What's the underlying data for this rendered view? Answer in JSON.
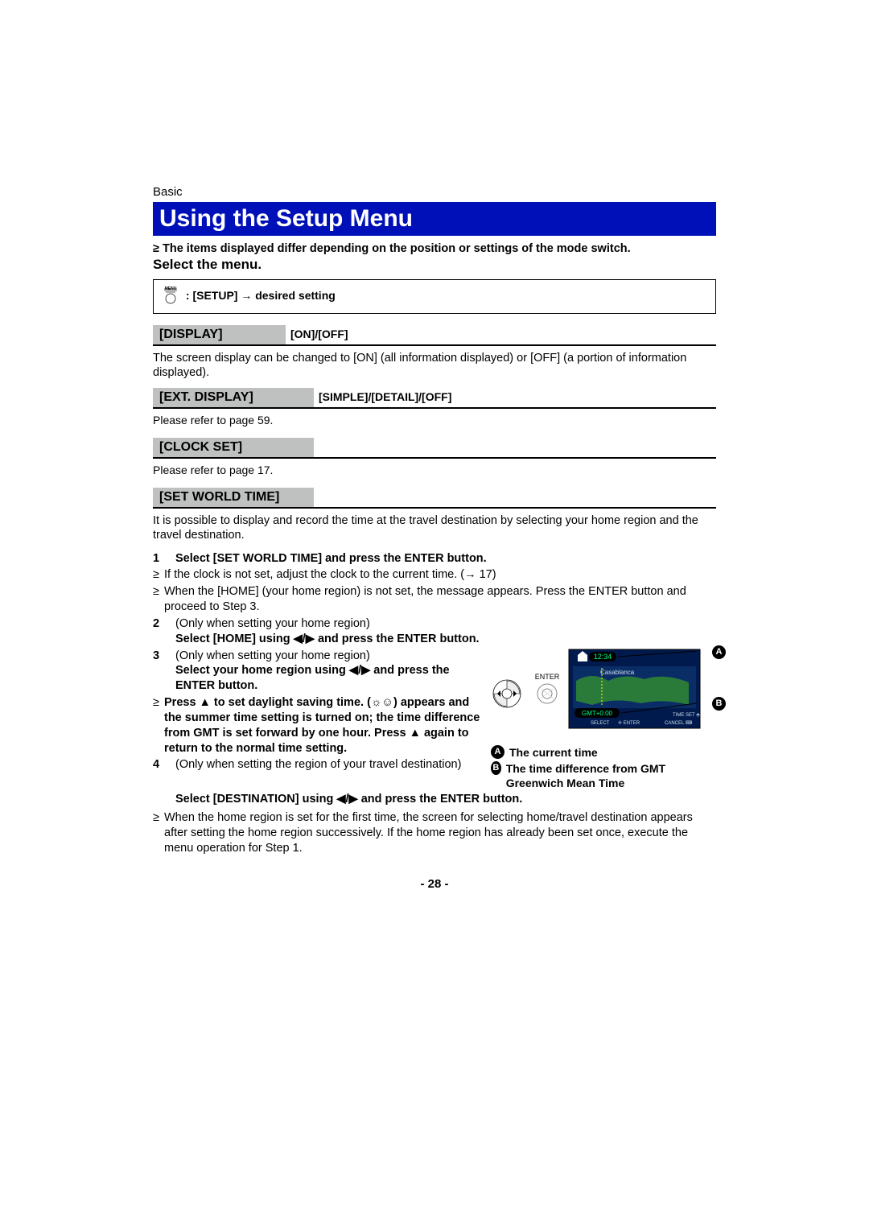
{
  "section_label": "Basic",
  "title": "Using the Setup Menu",
  "intro_bullet": "≥ The items displayed differ depending on the position or settings of the mode switch.",
  "select_menu": "Select the menu.",
  "menu_label_small": "MENU",
  "menu_path": ": [SETUP] → desired setting",
  "display": {
    "label": "[DISPLAY]",
    "opts": "[ON]/[OFF]",
    "desc": "The screen display can be changed to [ON] (all information displayed) or [OFF] (a portion of information displayed)."
  },
  "ext_display": {
    "label": "[EXT. DISPLAY]",
    "opts": "[SIMPLE]/[DETAIL]/[OFF]",
    "refer": "Please refer to page 59."
  },
  "clock_set": {
    "label": "[CLOCK SET]",
    "refer": "Please refer to page 17."
  },
  "world_time": {
    "label": "[SET WORLD TIME]",
    "desc": "It is possible to display and record the time at the travel destination by selecting your home region and the travel destination.",
    "step1": "Select [SET WORLD TIME] and press the ENTER button.",
    "step1_b1": "If the clock is not set, adjust the clock to the current time. (→ 17)",
    "step1_b2": "When the [HOME] (your home region) is not set, the message appears. Press the ENTER button and proceed to Step 3.",
    "step2_note": "(Only when setting your home region)",
    "step2": "Select [HOME] using ◀/▶ and press the ENTER button.",
    "step3_note": "(Only when setting your home region)",
    "step3a": "Select your home region using ◀/▶ and press the ENTER button.",
    "step3_bullet": "Press ▲ to set daylight saving time. (☼☺) appears and the summer time setting is turned on; the time difference from GMT is set forward by one hour. Press ▲ again to return to the normal time setting.",
    "step4_note": "(Only when setting the region of your travel destination)",
    "step4": "Select [DESTINATION] using ◀/▶ and press the ENTER button.",
    "final_bullet": "When the home region is set for the first time, the screen for selecting home/travel destination appears after setting the home region successively. If the home region has already been set once, execute the menu operation for Step 1."
  },
  "enter_label": "ENTER",
  "screen": {
    "time": "12:34",
    "city": "Casablanca",
    "gmt": "GMT+0:00",
    "timeset": "TIME SET",
    "select": "SELECT",
    "enter": "ENTER",
    "cancel": "CANCEL"
  },
  "legend": {
    "a": "The current time",
    "b": "The time difference from GMT Greenwich Mean Time"
  },
  "labels": {
    "A": "A",
    "B": "B"
  },
  "page_num": "- 28 -"
}
